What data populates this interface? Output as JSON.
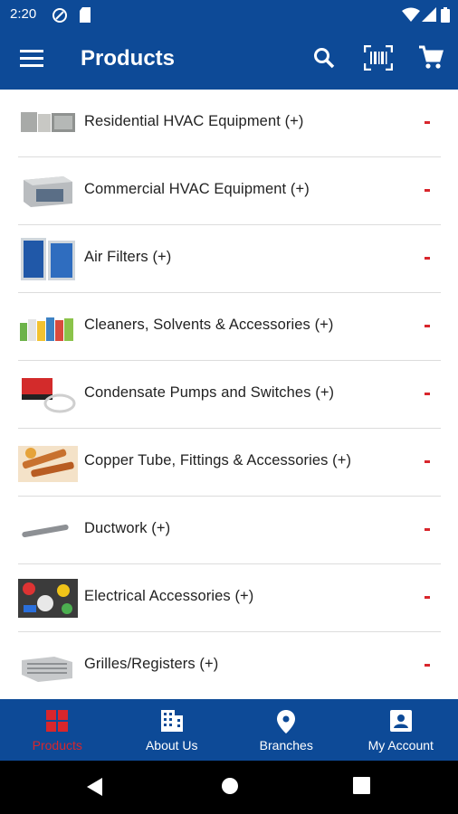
{
  "status_bar": {
    "time": "2:20"
  },
  "app_bar": {
    "title": "Products"
  },
  "categories": [
    {
      "label": "Residential HVAC Equipment (+)"
    },
    {
      "label": "Commercial HVAC Equipment (+)"
    },
    {
      "label": "Air Filters (+)"
    },
    {
      "label": "Cleaners, Solvents & Accessories (+)"
    },
    {
      "label": "Condensate Pumps and Switches (+)"
    },
    {
      "label": "Copper Tube, Fittings & Accessories (+)"
    },
    {
      "label": "Ductwork (+)"
    },
    {
      "label": "Electrical Accessories (+)"
    },
    {
      "label": "Grilles/Registers (+)"
    }
  ],
  "bottom_nav": {
    "items": [
      {
        "label": "Products",
        "icon": "grid-icon",
        "active": true
      },
      {
        "label": "About Us",
        "icon": "building-icon",
        "active": false
      },
      {
        "label": "Branches",
        "icon": "location-pin-icon",
        "active": false
      },
      {
        "label": "My Account",
        "icon": "account-box-icon",
        "active": false
      }
    ]
  },
  "colors": {
    "primary": "#0d4a97",
    "accent": "#d8262c",
    "text": "#222222"
  }
}
